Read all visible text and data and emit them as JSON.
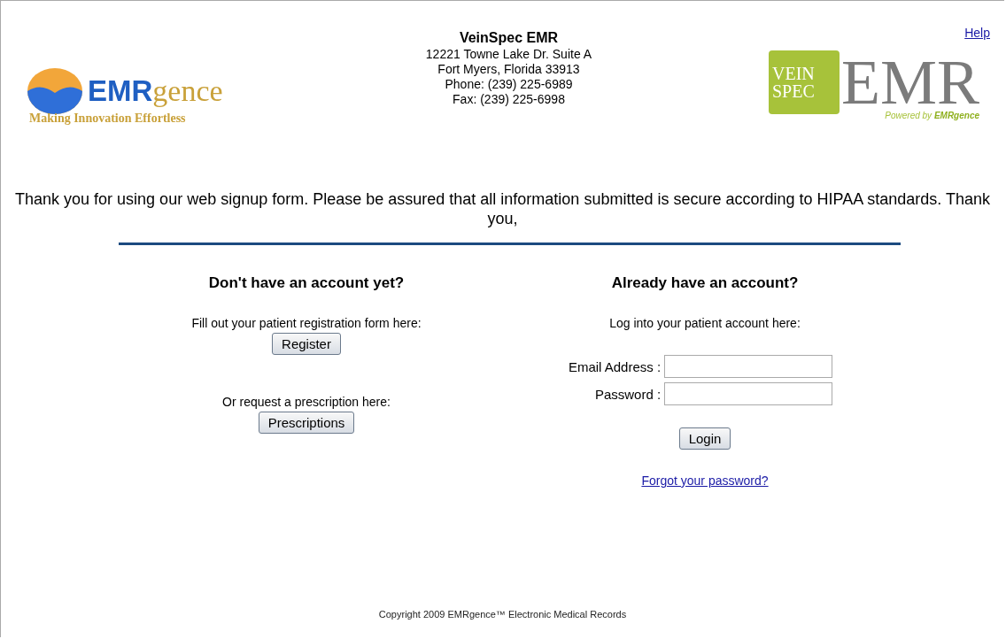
{
  "help_link": "Help",
  "left_logo": {
    "wordmark": "**EMR**gence",
    "tagline": "Making Innovation Effortless"
  },
  "clinic": {
    "name": "VeinSpec EMR",
    "lines": [
      "12221 Towne Lake Dr. Suite A",
      "Fort Myers, Florida 33913",
      "Phone: (239) 225-6989",
      "Fax: (239) 225-6998"
    ]
  },
  "right_logo": {
    "badge_lines": [
      "VEIN",
      "SPEC"
    ],
    "wordmark": "EMR",
    "tagline": "Powered by **EMRgence**"
  },
  "intro": "Thank you for using our web signup form. Please be assured that all information submitted is secure according to HIPAA standards. Thank you,",
  "register_panel": {
    "heading": "Don't have an account yet?",
    "items": [
      {
        "prompt": "Fill out your patient registration form here:",
        "button": "Register"
      },
      {
        "prompt": "Or request a prescription here:",
        "button": "Prescriptions"
      }
    ]
  },
  "login_panel": {
    "heading": "Already have an account?",
    "prompt": "Log into your patient account here:",
    "fields": [
      {
        "label": "Email Address :"
      },
      {
        "label": "Password :"
      }
    ],
    "button": "Login",
    "link": "Forgot your password?"
  },
  "footer": "Copyright 2009 EMRgence™ Electronic Medical Records"
}
